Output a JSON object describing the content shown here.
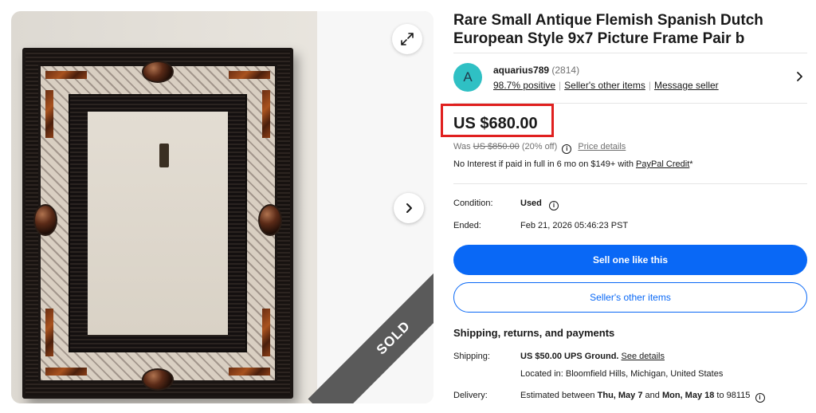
{
  "gallery": {
    "sold_label": "SOLD",
    "icons": {
      "expand": "expand-icon",
      "next": "chevron-right-icon"
    }
  },
  "listing": {
    "title": "Rare Small Antique Flemish Spanish Dutch European Style 9x7 Picture Frame Pair b"
  },
  "seller": {
    "avatar_letter": "A",
    "name": "aquarius789",
    "feedback_count": "(2814)",
    "positive": "98.7% positive",
    "other_items": "Seller's other items",
    "message": "Message seller"
  },
  "price": {
    "current": "US $680.00",
    "was_label": "Was",
    "was_value": "US $850.00",
    "discount": "(20% off)",
    "details_link": "Price details",
    "financing_text": "No Interest if paid in full in 6 mo on $149+ with",
    "financing_link": "PayPal Credit",
    "financing_suffix": "*"
  },
  "details": {
    "condition_label": "Condition:",
    "condition_value": "Used",
    "ended_label": "Ended:",
    "ended_value": "Feb 21, 2026 05:46:23 PST"
  },
  "actions": {
    "sell_one": "Sell one like this",
    "sellers_items": "Seller's other items"
  },
  "shipping": {
    "heading": "Shipping, returns, and payments",
    "shipping_label": "Shipping:",
    "shipping_value": "US $50.00 UPS Ground.",
    "see_details": "See details",
    "location": "Located in: Bloomfield Hills, Michigan, United States",
    "delivery_label": "Delivery:",
    "delivery_prefix": "Estimated between",
    "delivery_start": "Thu, May 7",
    "delivery_and": "and",
    "delivery_end": "Mon, May 18",
    "delivery_to": "to 98115"
  },
  "colors": {
    "accent": "#0968f6",
    "price_highlight": "#e0201f",
    "avatar": "#2fc0c4"
  }
}
